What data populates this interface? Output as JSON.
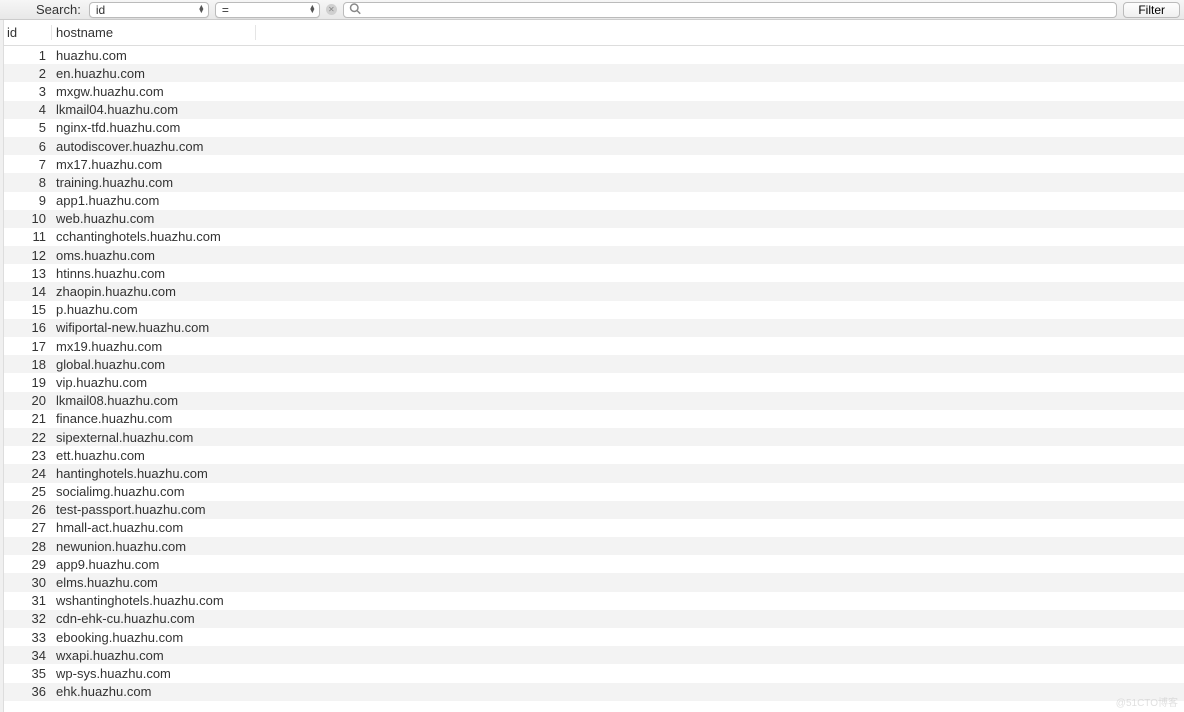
{
  "toolbar": {
    "search_label": "Search:",
    "field_select_value": "id",
    "operator_select_value": "=",
    "search_value": "",
    "search_placeholder": "",
    "filter_button_label": "Filter"
  },
  "table": {
    "columns": {
      "id": "id",
      "hostname": "hostname"
    },
    "rows": [
      {
        "id": "1",
        "hostname": "huazhu.com"
      },
      {
        "id": "2",
        "hostname": "en.huazhu.com"
      },
      {
        "id": "3",
        "hostname": "mxgw.huazhu.com"
      },
      {
        "id": "4",
        "hostname": "lkmail04.huazhu.com"
      },
      {
        "id": "5",
        "hostname": "nginx-tfd.huazhu.com"
      },
      {
        "id": "6",
        "hostname": "autodiscover.huazhu.com"
      },
      {
        "id": "7",
        "hostname": "mx17.huazhu.com"
      },
      {
        "id": "8",
        "hostname": "training.huazhu.com"
      },
      {
        "id": "9",
        "hostname": "app1.huazhu.com"
      },
      {
        "id": "10",
        "hostname": "web.huazhu.com"
      },
      {
        "id": "11",
        "hostname": "cchantinghotels.huazhu.com"
      },
      {
        "id": "12",
        "hostname": "oms.huazhu.com"
      },
      {
        "id": "13",
        "hostname": "htinns.huazhu.com"
      },
      {
        "id": "14",
        "hostname": "zhaopin.huazhu.com"
      },
      {
        "id": "15",
        "hostname": "p.huazhu.com"
      },
      {
        "id": "16",
        "hostname": "wifiportal-new.huazhu.com"
      },
      {
        "id": "17",
        "hostname": "mx19.huazhu.com"
      },
      {
        "id": "18",
        "hostname": "global.huazhu.com"
      },
      {
        "id": "19",
        "hostname": "vip.huazhu.com"
      },
      {
        "id": "20",
        "hostname": "lkmail08.huazhu.com"
      },
      {
        "id": "21",
        "hostname": "finance.huazhu.com"
      },
      {
        "id": "22",
        "hostname": "sipexternal.huazhu.com"
      },
      {
        "id": "23",
        "hostname": "ett.huazhu.com"
      },
      {
        "id": "24",
        "hostname": "hantinghotels.huazhu.com"
      },
      {
        "id": "25",
        "hostname": "socialimg.huazhu.com"
      },
      {
        "id": "26",
        "hostname": "test-passport.huazhu.com"
      },
      {
        "id": "27",
        "hostname": "hmall-act.huazhu.com"
      },
      {
        "id": "28",
        "hostname": "newunion.huazhu.com"
      },
      {
        "id": "29",
        "hostname": "app9.huazhu.com"
      },
      {
        "id": "30",
        "hostname": "elms.huazhu.com"
      },
      {
        "id": "31",
        "hostname": "wshantinghotels.huazhu.com"
      },
      {
        "id": "32",
        "hostname": "cdn-ehk-cu.huazhu.com"
      },
      {
        "id": "33",
        "hostname": "ebooking.huazhu.com"
      },
      {
        "id": "34",
        "hostname": "wxapi.huazhu.com"
      },
      {
        "id": "35",
        "hostname": "wp-sys.huazhu.com"
      },
      {
        "id": "36",
        "hostname": "ehk.huazhu.com"
      }
    ]
  },
  "watermark": "@51CTO博客"
}
